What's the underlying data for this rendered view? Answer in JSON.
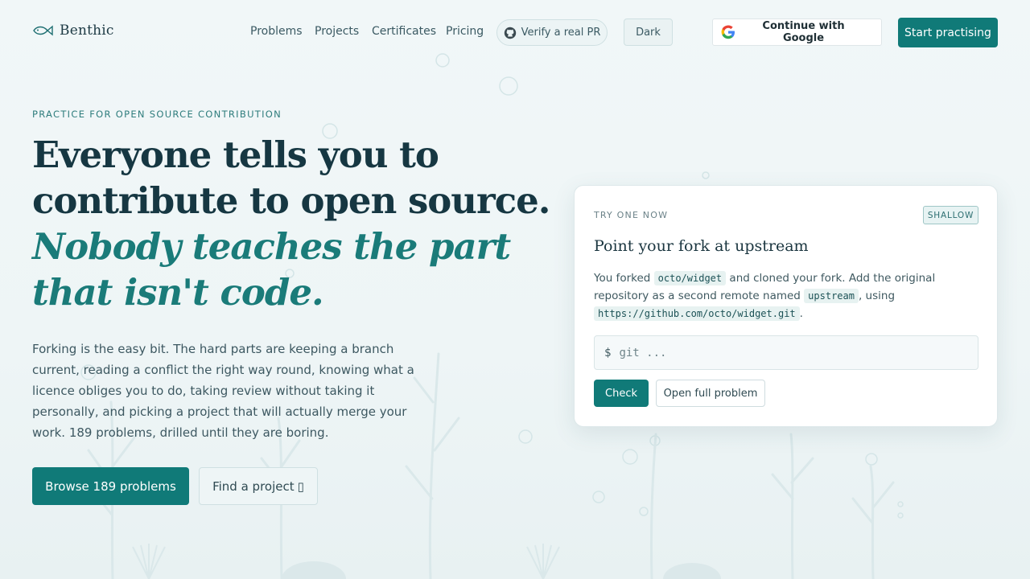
{
  "brand": {
    "name": "Benthic"
  },
  "nav": {
    "links": [
      "Problems",
      "Projects",
      "Certificates",
      "Pricing"
    ],
    "verify_label": "Verify a real PR",
    "theme_label": "Dark",
    "google_label": "Continue with Google",
    "cta_label": "Start practising"
  },
  "hero": {
    "eyebrow": "PRACTICE FOR OPEN SOURCE CONTRIBUTION",
    "headline_line1": "Everyone tells you to",
    "headline_line2": "contribute to open source.",
    "headline_italic1": "Nobody teaches the part",
    "headline_italic2": "that isn't code.",
    "lede": "Forking is the easy bit. The hard parts are keeping a branch current, reading a conflict the right way round, knowing what a licence obliges you to do, taking review without taking it personally, and picking a project that will actually merge your work. 189 problems, drilled until they are boring.",
    "primary_button": "Browse 189 problems",
    "secondary_button": "Find a project",
    "secondary_button_glyph": "▯"
  },
  "card": {
    "eyebrow": "TRY ONE NOW",
    "badge": "SHALLOW",
    "title": "Point your fork at upstream",
    "body_1": "You forked ",
    "code_1": "octo/widget",
    "body_2": " and cloned your fork. Add the original repository as a second remote named ",
    "code_2": "upstream",
    "body_3": ", using ",
    "code_3": "https://github.com/octo/widget.git",
    "body_4": ".",
    "prompt": "$",
    "input_placeholder": "git ...",
    "check_button": "Check",
    "open_button": "Open full problem"
  },
  "colors": {
    "accent": "#107a78",
    "background": "#eef5f6",
    "heading": "#163742",
    "italic_heading": "#1a7b79"
  },
  "icons": [
    "fish-logo-icon",
    "github-icon",
    "google-icon"
  ]
}
